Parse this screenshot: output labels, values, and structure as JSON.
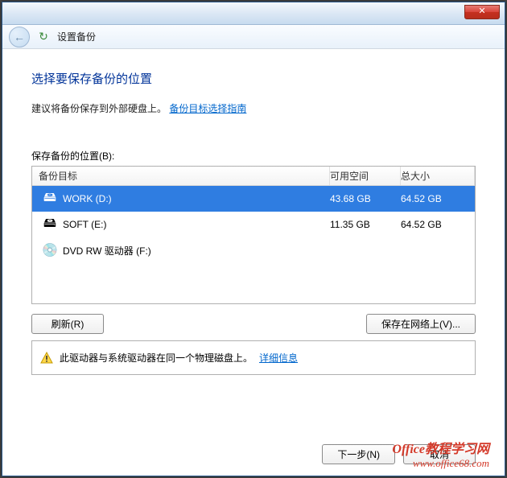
{
  "window": {
    "close_glyph": "✕"
  },
  "nav": {
    "back_arrow": "←",
    "app_icon": "↻",
    "title": "设置备份"
  },
  "main": {
    "heading": "选择要保存备份的位置",
    "subtext_prefix": "建议将备份保存到外部硬盘上。",
    "subtext_link": "备份目标选择指南",
    "list_label": "保存备份的位置(B):",
    "columns": {
      "target": "备份目标",
      "free": "可用空间",
      "total": "总大小"
    },
    "drives": [
      {
        "icon": "🖴",
        "name": "WORK (D:)",
        "free": "43.68 GB",
        "total": "64.52 GB",
        "selected": true
      },
      {
        "icon": "🖴",
        "name": "SOFT (E:)",
        "free": "11.35 GB",
        "total": "64.52 GB",
        "selected": false
      },
      {
        "icon": "💿",
        "name": "DVD RW 驱动器 (F:)",
        "free": "",
        "total": "",
        "selected": false
      }
    ],
    "refresh_label": "刷新(R)",
    "save_network_label": "保存在网络上(V)...",
    "info_text": "此驱动器与系统驱动器在同一个物理磁盘上。",
    "info_link": "详细信息"
  },
  "footer": {
    "next_label": "下一步(N)",
    "cancel_label": "取消"
  },
  "watermark": {
    "line1": "Office教程学习网",
    "line2": "www.office68.com"
  }
}
